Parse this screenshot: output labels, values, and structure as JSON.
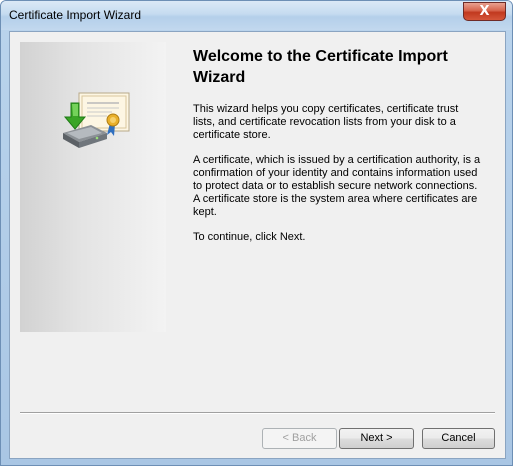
{
  "window": {
    "title": "Certificate Import Wizard",
    "close_glyph": "X"
  },
  "page": {
    "heading": "Welcome to the Certificate Import Wizard",
    "paragraphs": [
      "This wizard helps you copy certificates, certificate trust lists, and certificate revocation lists from your disk to a certificate store.",
      "A certificate, which is issued by a certification authority, is a confirmation of your identity and contains information used to protect data or to establish secure network connections. A certificate store is the system area where certificates are kept.",
      "To continue, click Next."
    ]
  },
  "buttons": {
    "back": "< Back",
    "next": "Next >",
    "cancel": "Cancel"
  },
  "icons": {
    "wizard_graphic": "certificate-import-icon",
    "close": "close-icon"
  },
  "colors": {
    "close_button": "#c1391f",
    "client_background": "#f0f0f0",
    "title_bar": "#c5dbf0",
    "arrow": "#3aa526"
  }
}
